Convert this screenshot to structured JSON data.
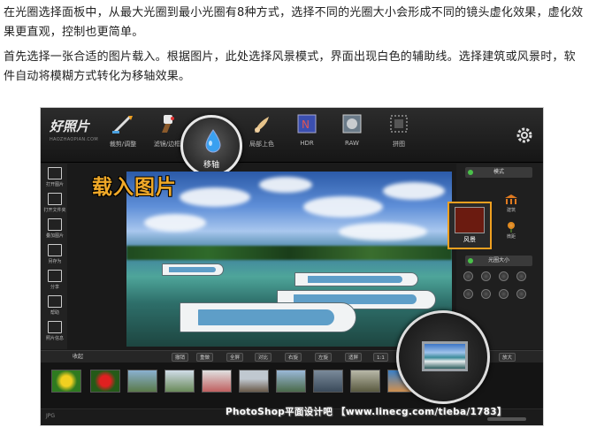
{
  "article": {
    "paragraph1": "在光圈选择面板中，从最大光圈到最小光圈有8种方式，选择不同的光圈大小会形成不同的镜头虚化效果，虚化效果更直观，控制也更简单。",
    "paragraph2": "首先选择一张合适的图片载入。根据图片，此处选择风景模式，界面出现白色的辅助线。选择建筑或风景时，软件自动将模糊方式转化为移轴效果。"
  },
  "app": {
    "logo": "好照片",
    "logo_url": "HAOZHAOPIAN.COM",
    "toolbar": [
      {
        "label": "裁剪/调整",
        "icon": "crop-pen-icon"
      },
      {
        "label": "滤镜/边框",
        "icon": "brush-icon"
      },
      {
        "label": "移轴",
        "icon": "water-drop-icon"
      },
      {
        "label": "局部上色",
        "icon": "color-brush-icon"
      },
      {
        "label": "HDR",
        "icon": "hdr-icon"
      },
      {
        "label": "RAW",
        "icon": "raw-icon"
      },
      {
        "label": "拼图",
        "icon": "collage-icon"
      }
    ],
    "settings_icon": "gear-icon",
    "overlay_heading": "载入图片",
    "left_menu": [
      {
        "label": "打开图片"
      },
      {
        "label": "打开文件夹"
      },
      {
        "label": "叠加图片"
      },
      {
        "label": "另存为"
      },
      {
        "label": "分享"
      },
      {
        "label": "帮助"
      },
      {
        "label": "照片信息"
      }
    ],
    "right_panel": {
      "mode_title": "模式",
      "mode_selected": "风景",
      "mode_options": [
        {
          "label": "建筑"
        },
        {
          "label": "微距"
        }
      ],
      "aperture_title": "光圈大小",
      "aperture_count": 8
    },
    "controls": {
      "fold": "收起",
      "buttons": [
        "撤销",
        "重做",
        "全屏",
        "对比",
        "右旋",
        "左旋",
        "适屏",
        "1:1"
      ],
      "zoom": "放大"
    },
    "status_file": "JPG",
    "colors": {
      "accent": "#f0a020",
      "heading": "#f0a928"
    }
  },
  "watermark": "PhotoShop平面设计吧 【www.linecg.com/tieba/1783】"
}
